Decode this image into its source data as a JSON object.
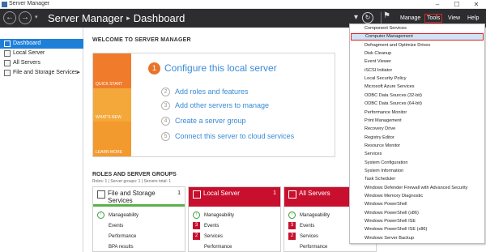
{
  "window": {
    "title": "Server Manager",
    "controls": [
      "–",
      "☐",
      "✕"
    ]
  },
  "header": {
    "breadcrumb_app": "Server Manager",
    "breadcrumb_separator": "▸",
    "breadcrumb_page": "Dashboard",
    "menus": [
      "Manage",
      "Tools",
      "View",
      "Help"
    ],
    "active_menu": "Tools"
  },
  "sidebar": {
    "items": [
      {
        "label": "Dashboard",
        "selected": true
      },
      {
        "label": "Local Server"
      },
      {
        "label": "All Servers"
      },
      {
        "label": "File and Storage Services",
        "expandable": true
      }
    ]
  },
  "welcome": {
    "title": "WELCOME TO SERVER MANAGER",
    "side_labels": [
      "QUICK START",
      "WHAT'S NEW",
      "LEARN MORE"
    ],
    "colors": {
      "quick_start": "#f07c2b",
      "whats_new": "#f5a83a",
      "learn_more": "#f39a2e",
      "link": "#3a8bd6"
    },
    "steps": [
      {
        "num": "1",
        "label": "Configure this local server"
      },
      {
        "num": "2",
        "label": "Add roles and features"
      },
      {
        "num": "3",
        "label": "Add other servers to manage"
      },
      {
        "num": "4",
        "label": "Create a server group"
      },
      {
        "num": "5",
        "label": "Connect this server to cloud services"
      }
    ]
  },
  "roles": {
    "title": "ROLES AND SERVER GROUPS",
    "summary": "Roles: 1  |  Server groups: 1  |  Servers total: 1",
    "tiles": [
      {
        "name": "File and Storage Services",
        "count": "1",
        "style": "white",
        "rows": [
          {
            "badge": "ok",
            "badge_text": "↑",
            "label": "Manageability"
          },
          {
            "badge": "none",
            "badge_text": "",
            "label": "Events"
          },
          {
            "badge": "none",
            "badge_text": "",
            "label": "Performance"
          },
          {
            "badge": "none",
            "badge_text": "",
            "label": "BPA results"
          }
        ]
      },
      {
        "name": "Local Server",
        "count": "1",
        "style": "red",
        "rows": [
          {
            "badge": "ok",
            "badge_text": "↑",
            "label": "Manageability"
          },
          {
            "badge": "err",
            "badge_text": "3",
            "label": "Events"
          },
          {
            "badge": "err",
            "badge_text": "2",
            "label": "Services"
          },
          {
            "badge": "none",
            "badge_text": "",
            "label": "Performance"
          }
        ]
      },
      {
        "name": "All Servers",
        "count": "1",
        "style": "red",
        "rows": [
          {
            "badge": "ok",
            "badge_text": "↑",
            "label": "Manageability"
          },
          {
            "badge": "err",
            "badge_text": "3",
            "label": "Events"
          },
          {
            "badge": "err",
            "badge_text": "2",
            "label": "Services"
          },
          {
            "badge": "none",
            "badge_text": "",
            "label": "Performance"
          }
        ]
      }
    ]
  },
  "tools_menu": {
    "highlighted": "Computer Management",
    "items": [
      "Component Services",
      "Computer Management",
      "Defragment and Optimize Drives",
      "Disk Cleanup",
      "Event Viewer",
      "iSCSI Initiator",
      "Local Security Policy",
      "Microsoft Azure Services",
      "ODBC Data Sources (32-bit)",
      "ODBC Data Sources (64-bit)",
      "Performance Monitor",
      "Print Management",
      "Recovery Drive",
      "Registry Editor",
      "Resource Monitor",
      "Services",
      "System Configuration",
      "System Information",
      "Task Scheduler",
      "Windows Defender Firewall with Advanced Security",
      "Windows Memory Diagnostic",
      "Windows PowerShell",
      "Windows PowerShell (x86)",
      "Windows PowerShell ISE",
      "Windows PowerShell ISE (x86)",
      "Windows Server Backup"
    ]
  }
}
